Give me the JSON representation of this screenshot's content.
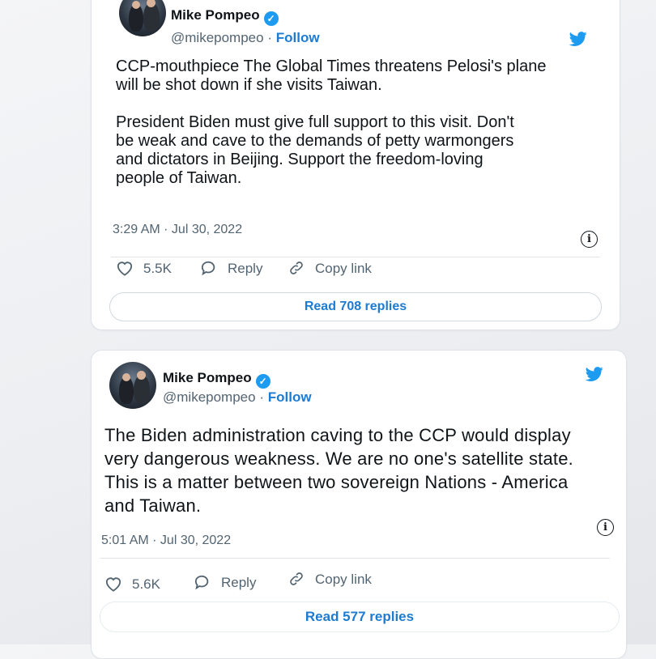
{
  "tweets": [
    {
      "author_name": "Mike Pompeo",
      "handle": "@mikepompeo",
      "separator": "·",
      "follow_label": "Follow",
      "body": "CCP-mouthpiece The Global Times threatens Pelosi's plane\nwill be shot down if she visits Taiwan.\n\nPresident Biden must give full support to this visit. Don't\nbe weak and cave to the demands of petty warmongers\nand dictators in Beijing. Support the freedom-loving\npeople of Taiwan.",
      "timestamp": "3:29 AM · Jul 30, 2022",
      "like_count": "5.5K",
      "reply_label": "Reply",
      "copy_link_label": "Copy link",
      "read_replies_label": "Read 708 replies"
    },
    {
      "author_name": "Mike Pompeo",
      "handle": "@mikepompeo",
      "separator": "·",
      "follow_label": "Follow",
      "body": "The Biden administration caving to the CCP would display\nvery dangerous weakness. We are no one's satellite state.\nThis is a matter between two sovereign Nations - America\nand Taiwan.",
      "timestamp": "5:01 AM · Jul 30, 2022",
      "like_count": "5.6K",
      "reply_label": "Reply",
      "copy_link_label": "Copy link",
      "read_replies_label": "Read 577 replies"
    }
  ],
  "icons": {
    "verified": "verified-badge-icon",
    "bird": "twitter-bird-icon",
    "info": "info-icon",
    "like": "heart-icon",
    "reply": "reply-bubble-icon",
    "copy": "link-icon"
  },
  "colors": {
    "accent": "#1d9bf0",
    "link": "#1d7bd1",
    "text": "#0f1419",
    "muted": "#536471"
  }
}
